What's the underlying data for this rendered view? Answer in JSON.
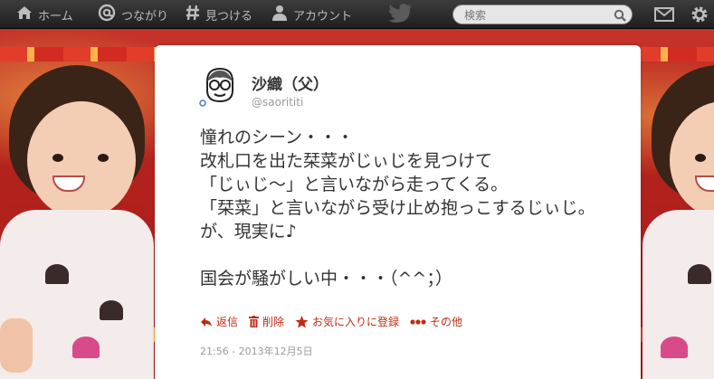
{
  "nav": {
    "home_label": "ホーム",
    "connect_label": "つながり",
    "discover_label": "見つける",
    "account_label": "アカウント",
    "search_placeholder": "検索"
  },
  "icons": [
    "home-icon",
    "at-icon",
    "hash-icon",
    "person-icon",
    "twitter-bird-icon",
    "search-icon",
    "mail-icon",
    "gear-icon"
  ],
  "tweet": {
    "display_name": "沙織（父）",
    "handle": "@saorititi",
    "text": "憧れのシーン・・・\n改札口を出た栞菜がじぃじを見つけて\n「じぃじ～」と言いながら走ってくる。\n「栞菜」と言いながら受け止め抱っこするじぃじ。\nが、現実に♪\n\n国会が騒がしい中・・・（^^；）",
    "actions": {
      "reply": "返信",
      "delete": "削除",
      "favorite": "お気に入りに登録",
      "more": "その他"
    },
    "timestamp": "21:56 - 2013年12月5日"
  },
  "colors": {
    "action_accent": "#c12b12",
    "topbar_bg": "#2a2a2a",
    "nav_text": "#bcbcbc"
  }
}
